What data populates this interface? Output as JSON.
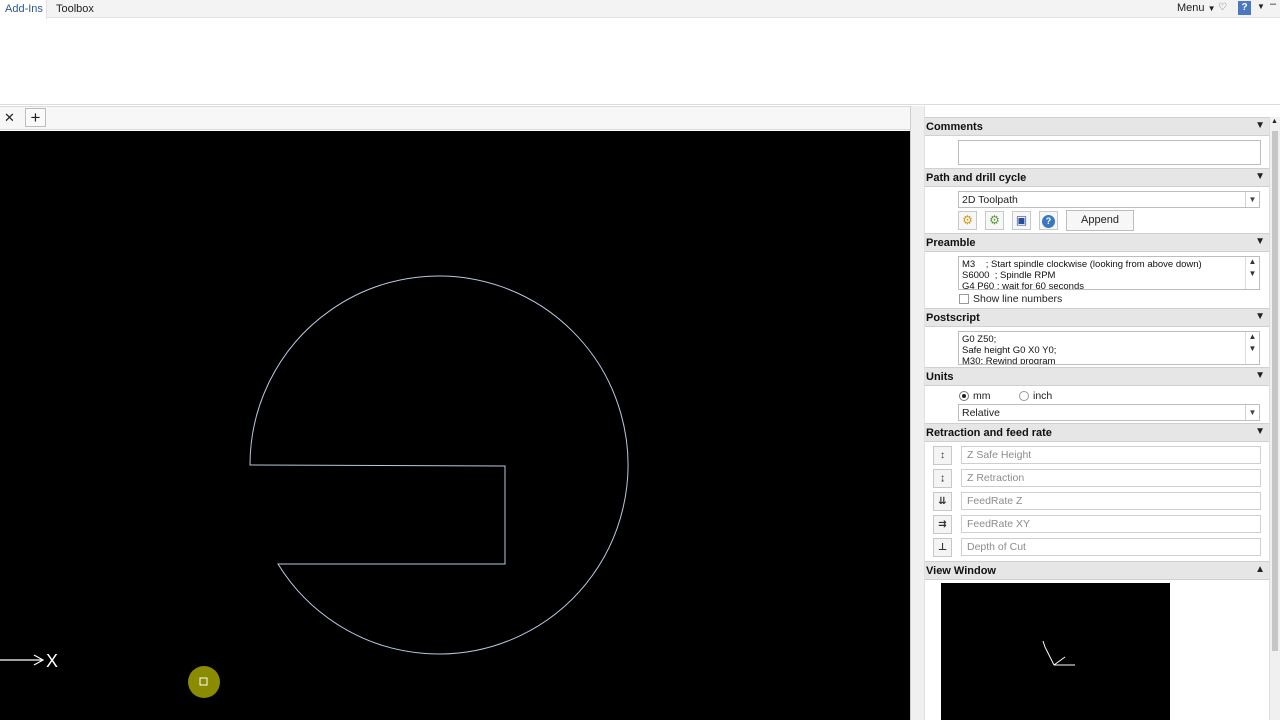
{
  "ribbon": {
    "tabs": [
      "Add-Ins",
      "Toolbox"
    ],
    "menu_label": "Menu",
    "help_label": "?"
  },
  "doc_tabs": {
    "close_glyph": "✕",
    "add_glyph": "+"
  },
  "canvas": {
    "axis_label": "X"
  },
  "panel": {
    "comments": {
      "title": "Comments",
      "value": ""
    },
    "path": {
      "title": "Path and drill cycle",
      "selected": "2D Toolpath",
      "append_label": "Append",
      "icons": [
        "load-icon",
        "load-alt-icon",
        "save-icon",
        "help-icon"
      ]
    },
    "preamble": {
      "title": "Preamble",
      "text": "M3    ; Start spindle clockwise (looking from above down)\nS6000  ; Spindle RPM\nG4 P60 ; wait for 60 seconds",
      "show_line_numbers": "Show line numbers"
    },
    "postscript": {
      "title": "Postscript",
      "text": "G0 Z50;\nSafe height G0 X0 Y0;\nM30; Rewind program"
    },
    "units": {
      "title": "Units",
      "mm": "mm",
      "inch": "inch",
      "selected_unit": "mm",
      "mode": "Relative"
    },
    "retraction": {
      "title": "Retraction and feed rate",
      "fields": [
        {
          "placeholder": "Z Safe Height",
          "icon": "z-safe-height-icon"
        },
        {
          "placeholder": "Z Retraction",
          "icon": "z-retraction-icon"
        },
        {
          "placeholder": "FeedRate Z",
          "icon": "feedrate-z-icon"
        },
        {
          "placeholder": "FeedRate XY",
          "icon": "feedrate-xy-icon"
        },
        {
          "placeholder": "Depth of Cut",
          "icon": "depth-of-cut-icon"
        }
      ]
    },
    "view_window": {
      "title": "View Window"
    }
  },
  "colors": {
    "canvas_bg": "#000000",
    "outline": "#b8c8e0",
    "cursor_marker": "#8b8b00",
    "tab_accent": "#2b5797"
  }
}
